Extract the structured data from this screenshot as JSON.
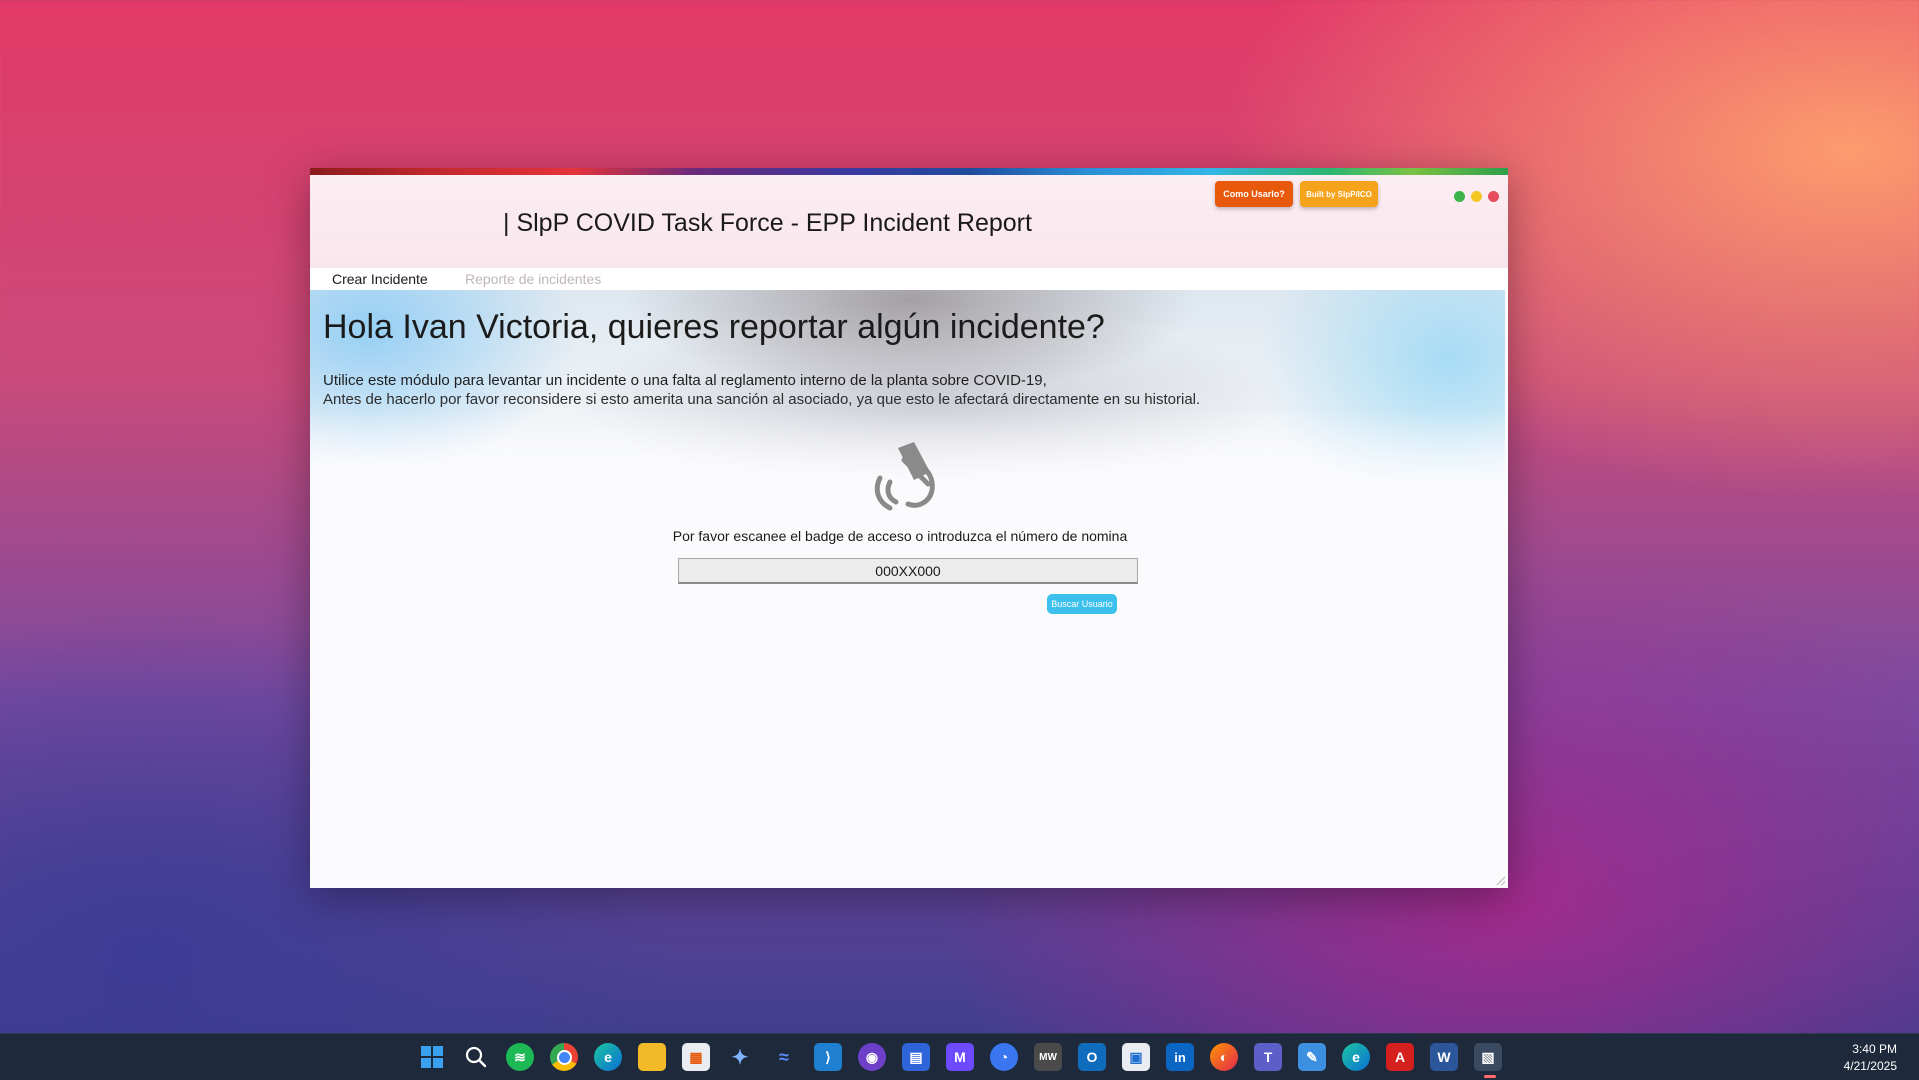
{
  "window": {
    "title": "| SlpP COVID Task Force - EPP Incident Report",
    "help_button": "Como Usarlo?",
    "built_button": "Built by SlpP/ICO",
    "controls": [
      "green-dot",
      "yellow-dot",
      "red-dot"
    ]
  },
  "tabs": [
    {
      "label": "Crear Incidente",
      "active": true
    },
    {
      "label": "Reporte de incidentes",
      "active": false
    }
  ],
  "main": {
    "greeting": "Hola Ivan Victoria, quieres reportar algún incidente?",
    "intro_line1": "Utilice este módulo para levantar un incidente o una falta al reglamento interno de la planta sobre COVID-19,",
    "intro_line2": "Antes de hacerlo por favor reconsidere si esto amerita una sanción al asociado, ya que esto le afectará directamente en su historial.",
    "scan_prompt": "Por favor escanee el badge de acceso o introduzca el número de nomina",
    "badge_input_value": "000XX000",
    "search_button": "Buscar Usuario"
  },
  "taskbar": {
    "icons": [
      "windows-start",
      "search",
      "spotify",
      "chrome",
      "edge",
      "file-explorer",
      "microsoft-store",
      "copilot",
      "deepseek",
      "vscode",
      "github",
      "calendar",
      "proton-mail",
      "signal",
      "minecraft",
      "outlook",
      "windows-app",
      "linkedin",
      "firefox",
      "teams",
      "paint",
      "edge-beta",
      "acrobat",
      "word",
      "task-manager"
    ],
    "time": "3:40 PM",
    "date": "4/21/2025"
  },
  "colors": {
    "help_button": "#e8590c",
    "built_button": "#f5a31a",
    "search_button": "#3cc0ee",
    "taskbar": "#1e2a3c"
  }
}
